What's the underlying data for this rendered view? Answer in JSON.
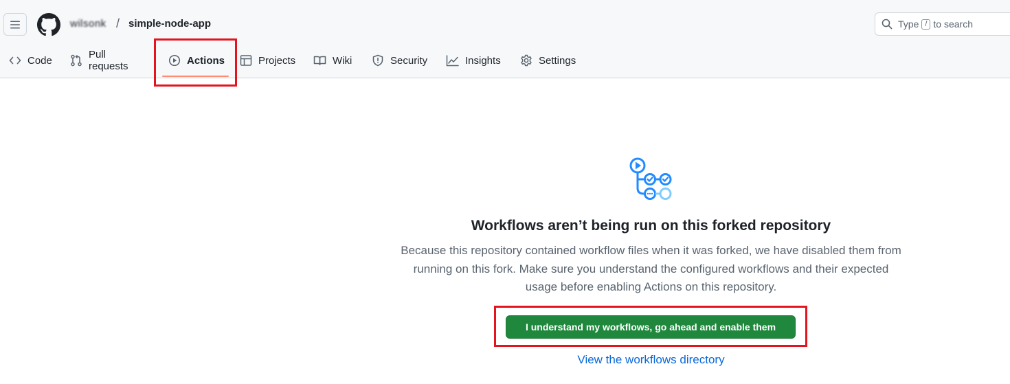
{
  "header": {
    "owner": "wilsonk",
    "separator": "/",
    "repo_name": "simple-node-app",
    "search": {
      "prefix": "Type",
      "key": "/",
      "suffix": "to search"
    }
  },
  "tabs": [
    {
      "label": "Code",
      "icon": "code-icon"
    },
    {
      "label": "Pull requests",
      "icon": "git-pull-request-icon"
    },
    {
      "label": "Actions",
      "icon": "play-icon",
      "active": true
    },
    {
      "label": "Projects",
      "icon": "table-icon"
    },
    {
      "label": "Wiki",
      "icon": "book-icon"
    },
    {
      "label": "Security",
      "icon": "shield-icon"
    },
    {
      "label": "Insights",
      "icon": "graph-icon"
    },
    {
      "label": "Settings",
      "icon": "gear-icon"
    }
  ],
  "main": {
    "title": "Workflows aren’t being run on this forked repository",
    "description_lines": [
      "Because this repository contained workflow files when it was forked, we have disabled them from",
      "running on this fork. Make sure you understand the configured workflows and their expected",
      "usage before enabling Actions on this repository."
    ],
    "enable_button": "I understand my workflows, go ahead and enable them",
    "workflows_link": "View the workflows directory"
  },
  "colors": {
    "accent_green": "#1f883d",
    "link_blue": "#0969da",
    "tab_underline": "#fd8c73",
    "highlight_red": "#e3141e"
  }
}
